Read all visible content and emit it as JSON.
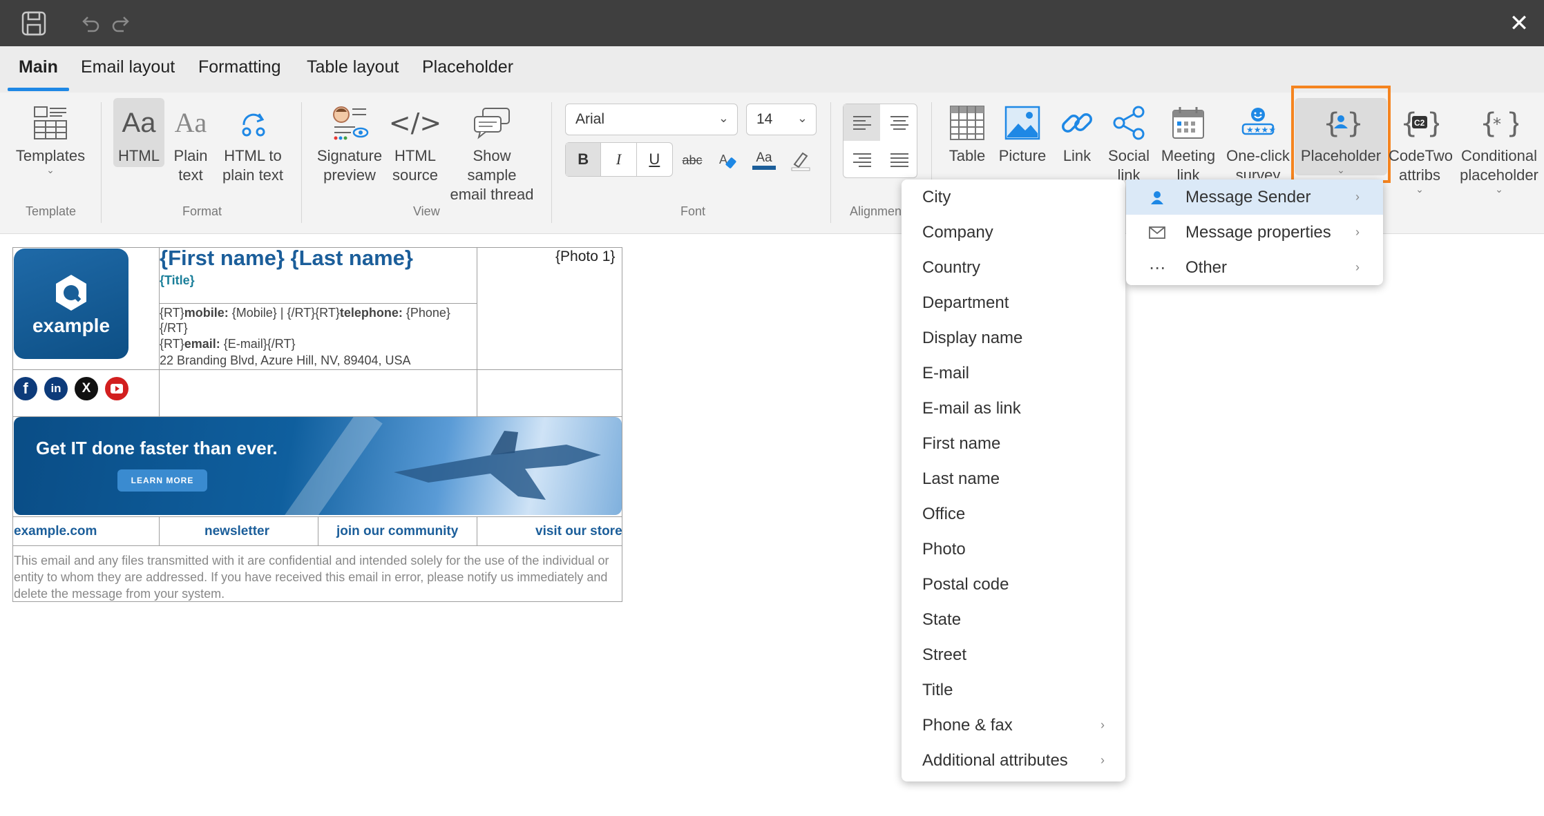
{
  "titlebar": {
    "save_icon": "save-icon",
    "undo_icon": "undo-icon",
    "redo_icon": "redo-icon",
    "close_icon": "close-icon"
  },
  "tabs": [
    "Main",
    "Email layout",
    "Formatting",
    "Table layout",
    "Placeholder"
  ],
  "ribbon": {
    "templates": {
      "label": "Templates",
      "group": "Template"
    },
    "format": {
      "html": "HTML",
      "plain1": "Plain",
      "plain2": "text",
      "htp1": "HTML to",
      "htp2": "plain text",
      "group": "Format"
    },
    "view": {
      "sig1": "Signature",
      "sig2": "preview",
      "src1": "HTML",
      "src2": "source",
      "thr1": "Show sample",
      "thr2": "email thread",
      "group": "View"
    },
    "font": {
      "family": "Arial",
      "size": "14",
      "bold": "B",
      "italic": "I",
      "underline": "U",
      "strike": "abc",
      "color": "Aa",
      "group": "Font"
    },
    "alignment": {
      "group": "Alignmen"
    },
    "insert": {
      "table": "Table",
      "picture": "Picture",
      "link": "Link",
      "social1": "Social",
      "social2": "link",
      "meeting1": "Meeting",
      "meeting2": "link",
      "survey1": "One-click",
      "survey2": "survey",
      "placeholder": "Placeholder",
      "codetwo1": "CodeTwo",
      "codetwo2": "attribs",
      "cond1": "Conditional",
      "cond2": "placeholder"
    }
  },
  "signature": {
    "logo_text": "example",
    "name": "{First name} {Last name}",
    "title": "{Title}",
    "photo": "{Photo 1}",
    "line1_pre": "{RT}",
    "line1_mobile": "mobile:",
    "line1_mobile_val": " {Mobile}  |  {/RT}{RT}",
    "line1_tel": "telephone:",
    "line1_tel_val": " {Phone}",
    "line2": "{/RT}",
    "line3_pre": "{RT}",
    "line3_email": "email:",
    "line3_val": " {E-mail}{/RT}",
    "address": "22 Branding Blvd, Azure Hill, NV, 89404, USA",
    "banner_text_a": "Get ",
    "banner_text_b": "IT",
    "banner_text_c": " done faster than ever.",
    "banner_button": "LEARN MORE",
    "links": [
      "example.com",
      "newsletter",
      "join our community",
      "visit our store"
    ],
    "disclaimer": "This email and any files transmitted with it are confidential and intended solely for the use of the individual or entity to whom they are addressed. If you have received this email in error, please notify us immediately and delete the message from your system."
  },
  "placeholder_menu": {
    "items": [
      "Message Sender",
      "Message properties",
      "Other"
    ]
  },
  "sender_menu": {
    "items": [
      "City",
      "Company",
      "Country",
      "Department",
      "Display name",
      "E-mail",
      "E-mail as link",
      "First name",
      "Last name",
      "Office",
      "Photo",
      "Postal code",
      "State",
      "Street",
      "Title",
      "Phone & fax",
      "Additional attributes"
    ]
  },
  "colors": {
    "accent": "#1e88e5",
    "highlight": "#f5841f",
    "brand": "#1b5e9a"
  }
}
